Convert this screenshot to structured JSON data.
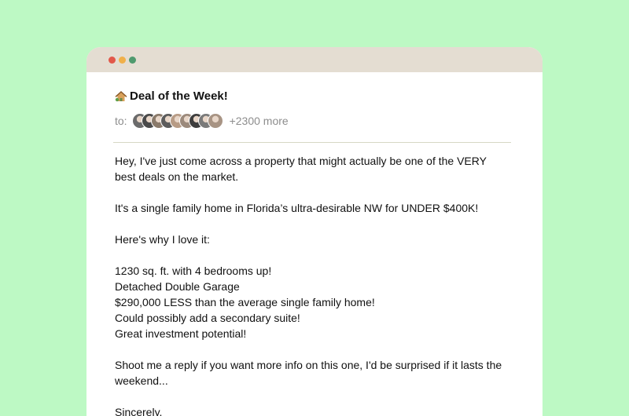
{
  "email": {
    "subject": "Deal of the Week!",
    "to_label": "to:",
    "recipients_more": "+2300 more",
    "avatars": [
      {
        "color": "#6b6b6b"
      },
      {
        "color": "#4a4a4a"
      },
      {
        "color": "#8a7a6a"
      },
      {
        "color": "#5c5c5c"
      },
      {
        "color": "#b89c86"
      },
      {
        "color": "#9c8a7c"
      },
      {
        "color": "#3e3e3e"
      },
      {
        "color": "#7a7a7a"
      },
      {
        "color": "#a89484"
      }
    ],
    "body": {
      "p1_line1": "Hey, I've just come across a property that might actually be one of the VERY",
      "p1_line2": "best deals on the market.",
      "p2": "It's a single family home in Florida’s ultra-desirable NW for UNDER $400K!",
      "p3": "Here's why I love it:",
      "bullets": [
        "1230 sq. ft. with 4 bedrooms up!",
        "Detached Double Garage",
        "$290,000 LESS than the average single family home!",
        "Could possibly add a secondary suite!",
        "Great investment potential!"
      ],
      "p5_line1": "Shoot me a reply if you want more info on this one, I'd be surprised if it lasts the",
      "p5_line2": "weekend...",
      "signoff": "Sincerely,"
    }
  },
  "colors": {
    "background": "#bdf9c4",
    "titlebar": "#e4ddd2",
    "dot_red": "#e2584a",
    "dot_yellow": "#f0b04a",
    "dot_green": "#4f9a6e"
  },
  "icons": {
    "subject_icon": "house-icon"
  }
}
